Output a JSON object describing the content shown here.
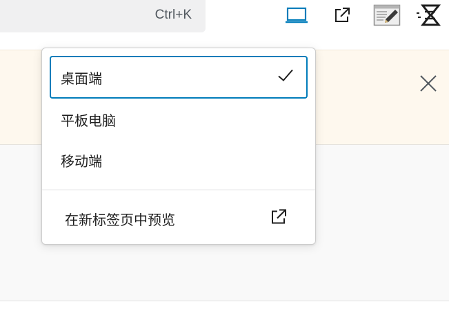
{
  "toolbar": {
    "shortcut": "Ctrl+K",
    "icons": [
      "desktop-icon",
      "external-link-icon",
      "edit-panel-icon",
      "quick-action-icon"
    ],
    "accent_color": "#007cba"
  },
  "device_menu": {
    "items": [
      {
        "label": "桌面端",
        "selected": true
      },
      {
        "label": "平板电脑",
        "selected": false
      },
      {
        "label": "移动端",
        "selected": false
      }
    ],
    "preview_label": "在新标签页中预览"
  },
  "notice": {
    "close_icon": "close-icon",
    "background_color": "#fef8ee"
  }
}
